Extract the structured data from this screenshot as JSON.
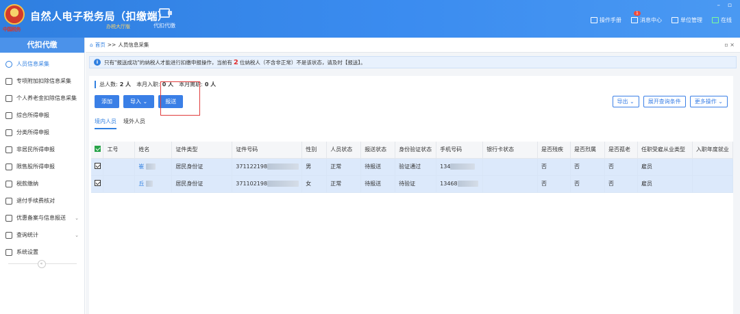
{
  "app": {
    "title": "自然人电子税务局（扣缴端）",
    "subtitle": "办税大厅版",
    "emblem_text": "中国税务",
    "module_label": "代扣代缴"
  },
  "topbar": {
    "manual": "操作手册",
    "messages": "消息中心",
    "messages_badge": "1",
    "unit": "单位管理",
    "online": "在线"
  },
  "sidebar": {
    "header": "代扣代缴",
    "items": [
      {
        "label": "人员信息采集",
        "active": true
      },
      {
        "label": "专项附加扣除信息采集"
      },
      {
        "label": "个人养老金扣除信息采集"
      },
      {
        "label": "综合所得申报"
      },
      {
        "label": "分类所得申报"
      },
      {
        "label": "非居民所得申报"
      },
      {
        "label": "限售股所得申报"
      },
      {
        "label": "税款缴纳"
      },
      {
        "label": "退付手续费核对"
      },
      {
        "label": "优惠备案与信息报送",
        "caret": "⌄"
      },
      {
        "label": "查询统计",
        "caret": "⌄"
      },
      {
        "label": "系统设置"
      }
    ],
    "collapse": "«"
  },
  "breadcrumb": {
    "home": "首页",
    "sep": ">>",
    "current": "人员信息采集"
  },
  "notice": {
    "pre": "只有\"报送成功\"的纳税人才能进行扣缴申报操作，当前有",
    "count": "2",
    "post": "位纳税人（不含非正常）不是该状态，请及时【报送】。"
  },
  "stats": {
    "total_label": "总人数:",
    "total": "2 人",
    "hired_label": "本月入职:",
    "hired": "0 人",
    "left_label": "本月离职:",
    "left": "0 人"
  },
  "buttons": {
    "add": "添加",
    "import": "导入 ⌄",
    "submit": "报送",
    "export": "导出 ⌄",
    "query": "展开查询条件",
    "more": "更多操作 ⌄"
  },
  "tabs": [
    "境内人员",
    "境外人员"
  ],
  "table": {
    "headers": [
      "",
      "工号",
      "姓名",
      "证件类型",
      "证件号码",
      "性别",
      "人员状态",
      "报送状态",
      "身份验证状态",
      "手机号码",
      "银行卡状态",
      "是否残疾",
      "是否烈属",
      "是否孤老",
      "任职受雇从业类型",
      "入职年度就业"
    ],
    "rows": [
      {
        "id_no": "371122198",
        "name": "崔",
        "id_type": "居民身份证",
        "gender": "男",
        "status": "正常",
        "report": "待报送",
        "verify": "验证通过",
        "phone": "134",
        "disabled": "否",
        "martyr": "否",
        "elderly": "否",
        "emp_type": "雇员"
      },
      {
        "id_no": "371102198",
        "name": "丘",
        "id_type": "居民身份证",
        "gender": "女",
        "status": "正常",
        "report": "待报送",
        "verify": "待验证",
        "phone": "13468",
        "disabled": "否",
        "martyr": "否",
        "elderly": "否",
        "emp_type": "雇员"
      }
    ]
  }
}
